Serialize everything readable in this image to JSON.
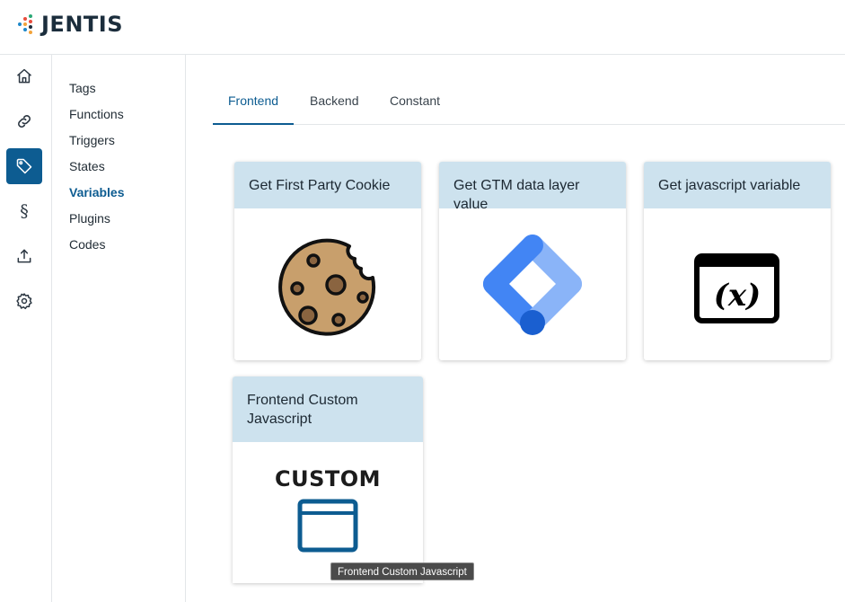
{
  "app": {
    "brand": "JENTIS"
  },
  "rail": {
    "items": [
      {
        "icon": "home-icon"
      },
      {
        "icon": "link-icon"
      },
      {
        "icon": "tag-icon",
        "active": true
      },
      {
        "icon": "section-icon",
        "glyph": "§"
      },
      {
        "icon": "upload-icon"
      },
      {
        "icon": "gear-icon"
      }
    ]
  },
  "subnav": {
    "items": [
      {
        "label": "Tags"
      },
      {
        "label": "Functions"
      },
      {
        "label": "Triggers"
      },
      {
        "label": "States"
      },
      {
        "label": "Variables",
        "active": true
      },
      {
        "label": "Plugins"
      },
      {
        "label": "Codes"
      }
    ]
  },
  "tabs": [
    {
      "label": "Frontend",
      "active": true
    },
    {
      "label": "Backend"
    },
    {
      "label": "Constant"
    }
  ],
  "cards": [
    {
      "title": "Get First Party Cookie",
      "icon": "cookie-icon"
    },
    {
      "title": "Get GTM data layer value",
      "icon": "gtm-icon"
    },
    {
      "title": "Get javascript variable",
      "icon": "variable-icon",
      "icon_text": "(x)"
    },
    {
      "title": "Frontend Custom Javascript",
      "icon": "custom-window-icon",
      "icon_text": "CUSTOM"
    }
  ],
  "tooltip": {
    "text": "Frontend Custom Javascript"
  },
  "colors": {
    "accent": "#0d5c91",
    "card_header": "#cde2ee"
  }
}
